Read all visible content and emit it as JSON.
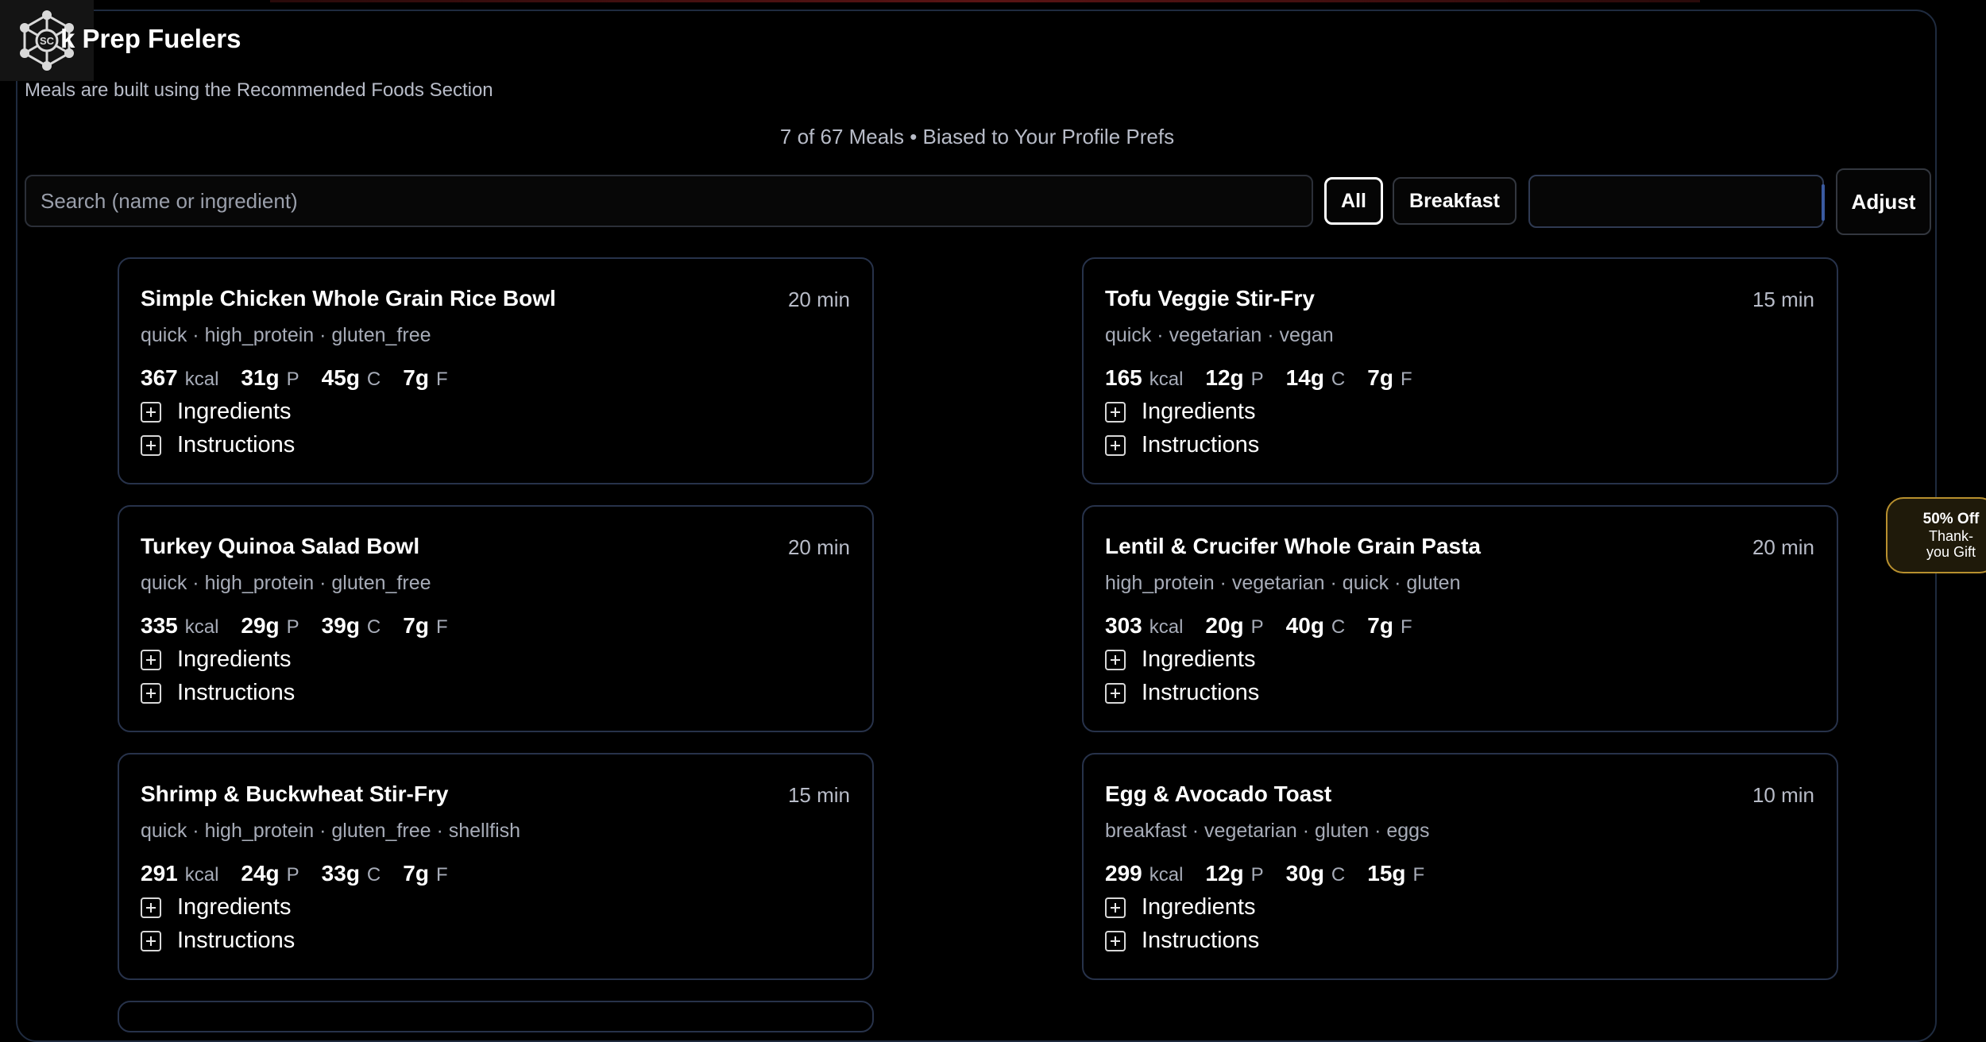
{
  "header": {
    "title_partial": "k Prep Fuelers",
    "subtitle": "Meals are built using the Recommended Foods Section",
    "meal_count": "7 of 67 Meals • Biased to Your Profile Prefs"
  },
  "filters": {
    "search_placeholder": "Search (name or ingredient)",
    "chips": [
      {
        "label": "All",
        "active": true
      },
      {
        "label": "Breakfast",
        "active": false
      }
    ],
    "select_value": "",
    "adjust_label": "Adjust"
  },
  "labels": {
    "ingredients": "Ingredients",
    "instructions": "Instructions",
    "kcal": "kcal",
    "p": "P",
    "c": "C",
    "f": "F"
  },
  "meals": [
    {
      "name": "Simple Chicken Whole Grain Rice Bowl",
      "time": "20 min",
      "tags": "quick · high_protein · gluten_free",
      "kcal": "367",
      "protein": "31g",
      "carbs": "45g",
      "fat": "7g"
    },
    {
      "name": "Tofu Veggie Stir-Fry",
      "time": "15 min",
      "tags": "quick · vegetarian · vegan",
      "kcal": "165",
      "protein": "12g",
      "carbs": "14g",
      "fat": "7g"
    },
    {
      "name": "Turkey Quinoa Salad Bowl",
      "time": "20 min",
      "tags": "quick · high_protein · gluten_free",
      "kcal": "335",
      "protein": "29g",
      "carbs": "39g",
      "fat": "7g"
    },
    {
      "name": "Lentil & Crucifer Whole Grain Pasta",
      "time": "20 min",
      "tags": "high_protein · vegetarian · quick · gluten",
      "kcal": "303",
      "protein": "20g",
      "carbs": "40g",
      "fat": "7g"
    },
    {
      "name": "Shrimp & Buckwheat Stir-Fry",
      "time": "15 min",
      "tags": "quick · high_protein · gluten_free · shellfish",
      "kcal": "291",
      "protein": "24g",
      "carbs": "33g",
      "fat": "7g"
    },
    {
      "name": "Egg & Avocado Toast",
      "time": "10 min",
      "tags": "breakfast · vegetarian · gluten · eggs",
      "kcal": "299",
      "protein": "12g",
      "carbs": "30g",
      "fat": "15g"
    }
  ],
  "gift": {
    "title": "50% Off",
    "subtitle": "Thank-you Gift"
  }
}
